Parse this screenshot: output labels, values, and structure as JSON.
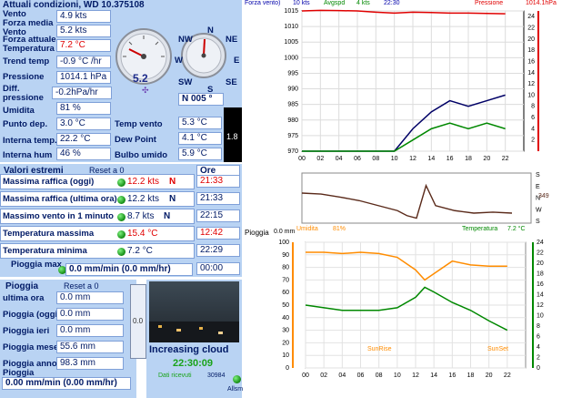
{
  "current": {
    "header": "Attuali condizioni, WD 10.375108",
    "rows": [
      {
        "label": "Vento",
        "value": "4.9 kts"
      },
      {
        "label": "Forza media\nVento",
        "value": "5.2 kts"
      },
      {
        "label": "Forza attuale\nTemperatura",
        "value": "7.2 °C"
      },
      {
        "label": "Trend temp",
        "value": "-0.9 °C /hr"
      },
      {
        "label": "Pressione",
        "value": "1014.1 hPa"
      },
      {
        "label": "Diff.\npressione",
        "value": "-0.2hPa/hr"
      },
      {
        "label": "Umidita",
        "value": "81 %"
      },
      {
        "label": "Punto dep.",
        "value": "3.0 °C"
      },
      {
        "label": "Interna temp.",
        "value": "22.2 °C"
      },
      {
        "label": "Interna hum",
        "value": "46 %"
      }
    ],
    "right_rows": [
      {
        "label": "Temp vento",
        "value": "5.3 °C"
      },
      {
        "label": "Dew Point",
        "value": "4.1 °C"
      },
      {
        "label": "Bulbo umido",
        "value": "5.9 °C"
      }
    ],
    "gauge_value": "5.2",
    "compass": {
      "n": "N",
      "ne": "NE",
      "e": "E",
      "se": "SE",
      "s": "S",
      "sw": "SW",
      "w": "W",
      "nw": "NW"
    },
    "direction": "N  005 °",
    "uv": "1.8"
  },
  "extremes": {
    "header": "Valori estremi",
    "reset": "Reset a 0",
    "ore_header": "Ore",
    "rows": [
      {
        "label": "Massima raffica (oggi)",
        "value": "12.2 kts",
        "dir": "N",
        "time": "21:33",
        "red": true
      },
      {
        "label": "Massima raffica (ultima ora)",
        "value": "12.2 kts",
        "dir": "N",
        "time": "21:33",
        "red": false
      },
      {
        "label": "Massimo vento in 1 minuto",
        "value": "8.7 kts",
        "dir": "N",
        "time": "22:15",
        "red": false
      },
      {
        "label": "Temperatura massima",
        "value": "15.4 °C",
        "dir": "",
        "time": "12:42",
        "red": true
      },
      {
        "label": "Temperatura minima",
        "value": "7.2 °C",
        "dir": "",
        "time": "22:29",
        "red": false
      }
    ],
    "rain_max_label": "Pioggia max",
    "rain_max_value": "0.0 mm/min (0.0 mm/hr)",
    "rain_max_time": "00:00"
  },
  "rain": {
    "header": "Pioggia",
    "reset": "Reset a 0",
    "rows": [
      {
        "label": "ultima ora",
        "value": "0.0 mm"
      },
      {
        "label": "Pioggia (oggi)",
        "value": "0.0 mm"
      },
      {
        "label": "Pioggia ieri",
        "value": "0.0 mm"
      },
      {
        "label": "Pioggia mese",
        "value": "55.6 mm"
      },
      {
        "label": "Pioggia anno",
        "value": "98.3 mm"
      }
    ],
    "rate_label": "Pioggia",
    "rate_value": "0.00 mm/min (0.00 mm/hr)",
    "bar_value": "0.0",
    "sky": "Increasing cloud",
    "clock": "22:30:09",
    "received_label": "Dati ricevuti",
    "received_count": "30984",
    "status": "Allsm"
  },
  "chart_data": [
    {
      "type": "line",
      "legend": [
        {
          "label": "Forza vento)",
          "color": "#0000aa"
        },
        {
          "label": "10 kts",
          "color": "#0000aa"
        },
        {
          "label": "Avgspd",
          "color": "#008800"
        },
        {
          "label": "4 kts",
          "color": "#008800"
        },
        {
          "label": "22:30",
          "color": "#0000aa"
        },
        {
          "label": "Pressione",
          "color": "#e00000"
        },
        {
          "label": "1014.1hPa",
          "color": "#e00000"
        }
      ],
      "x": [
        0,
        2,
        4,
        6,
        8,
        10,
        12,
        14,
        16,
        18,
        20,
        22
      ],
      "x_ticks": [
        "00",
        "02",
        "04",
        "06",
        "08",
        "10",
        "12",
        "14",
        "16",
        "18",
        "20",
        "22"
      ],
      "y_left_ticks": [
        "970",
        "975",
        "980",
        "985",
        "990",
        "995",
        "1000",
        "1005",
        "1010",
        "1015"
      ],
      "y_left_range": [
        970,
        1015
      ],
      "y_right_ticks": [
        "2",
        "4",
        "6",
        "8",
        "10",
        "12",
        "14",
        "16",
        "18",
        "20",
        "22",
        "24"
      ],
      "y_right_range": [
        0,
        25
      ],
      "series": [
        {
          "name": "Pressione",
          "color": "#e00000",
          "axis": "left",
          "values": [
            1015,
            1015.2,
            1015.1,
            1015,
            1014.6,
            1014.3,
            1014.6,
            1014.5,
            1014.3,
            1014.3,
            1014.2,
            1014.1
          ]
        },
        {
          "name": "Forza vento",
          "color": "#000066",
          "axis": "right",
          "values": [
            0,
            0,
            0,
            0,
            0,
            0,
            4,
            7,
            9,
            8,
            9,
            10
          ]
        },
        {
          "name": "Avgspd",
          "color": "#008800",
          "axis": "right",
          "values": [
            0,
            0,
            0,
            0,
            0,
            0,
            2,
            4,
            5,
            4,
            5,
            4
          ]
        }
      ]
    },
    {
      "type": "line",
      "x": [
        0,
        2,
        4,
        6,
        8,
        10,
        11,
        12,
        13,
        14,
        16,
        18,
        20,
        22
      ],
      "y_right_labels": [
        "S",
        "E",
        "N",
        "W",
        "S"
      ],
      "dir_value": "349",
      "series": [
        {
          "name": "Direction",
          "color": "#5a2a1a",
          "values": [
            60,
            58,
            52,
            45,
            35,
            25,
            15,
            10,
            75,
            35,
            25,
            20,
            22,
            20
          ]
        }
      ]
    },
    {
      "type": "line",
      "title": "Pioggia",
      "title_value": "0.0 mm",
      "x_ticks": [
        "00",
        "02",
        "04",
        "06",
        "08",
        "10",
        "12",
        "14",
        "16",
        "18",
        "20",
        "22"
      ],
      "y_left_ticks": [
        "0",
        "10",
        "20",
        "30",
        "40",
        "50",
        "60",
        "70",
        "80",
        "90",
        "100"
      ],
      "y_left_range": [
        0,
        100
      ],
      "y_right_ticks": [
        "0",
        "2",
        "4",
        "6",
        "8",
        "10",
        "12",
        "14",
        "16",
        "18",
        "20",
        "22",
        "24"
      ],
      "y_right_range": [
        0,
        24
      ],
      "labels": [
        {
          "label": "Umidita",
          "color": "#ff8c00"
        },
        {
          "label": "81%",
          "color": "#ff8c00"
        },
        {
          "label": "Temperatura",
          "color": "#008800"
        },
        {
          "label": "7.2 °C",
          "color": "#008800"
        }
      ],
      "annotations": [
        "SunRise",
        "SunSet"
      ],
      "series": [
        {
          "name": "Umidita",
          "color": "#ff8c00",
          "axis": "left",
          "x": [
            0,
            2,
            4,
            6,
            8,
            10,
            12,
            13,
            14,
            16,
            18,
            20,
            22
          ],
          "values": [
            92,
            92,
            91,
            92,
            91,
            88,
            78,
            70,
            75,
            85,
            82,
            81,
            81
          ]
        },
        {
          "name": "Temperatura",
          "color": "#008800",
          "axis": "right",
          "x": [
            0,
            2,
            4,
            6,
            8,
            10,
            12,
            13,
            14,
            16,
            18,
            20,
            22
          ],
          "values": [
            12,
            11.5,
            11,
            11,
            11,
            11.5,
            13.5,
            15.4,
            14.5,
            12.5,
            11,
            9,
            7.2
          ]
        }
      ]
    }
  ]
}
